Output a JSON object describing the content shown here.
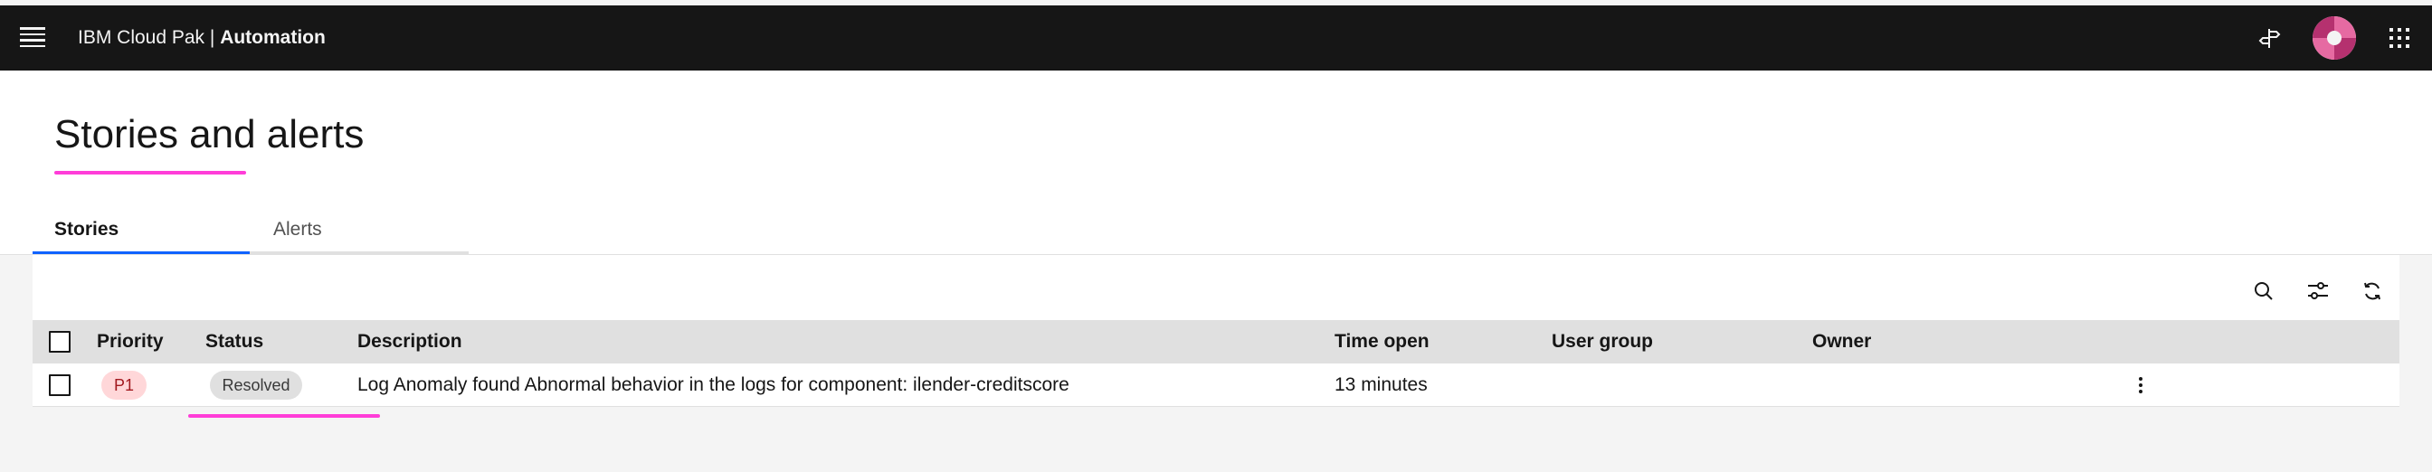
{
  "header": {
    "brand_prefix": "IBM Cloud Pak | ",
    "brand_name": "Automation",
    "icons": [
      "menu-icon",
      "signpost-icon",
      "avatar-icon",
      "app-switcher-icon"
    ]
  },
  "page": {
    "title": "Stories and alerts",
    "accent_color": "#ff3dd8"
  },
  "tabs": [
    {
      "label": "Stories",
      "selected": true
    },
    {
      "label": "Alerts",
      "selected": false
    }
  ],
  "toolbar": {
    "icons": [
      "search-icon",
      "filter-settings-icon",
      "refresh-icon"
    ]
  },
  "table": {
    "columns": [
      "Priority",
      "Status",
      "Description",
      "Time open",
      "User group",
      "Owner"
    ],
    "rows": [
      {
        "priority": "P1",
        "status": "Resolved",
        "description": "Log Anomaly found Abnormal behavior in the logs for component: ilender-creditscore",
        "time_open": "13 minutes",
        "user_group": "",
        "owner": ""
      }
    ]
  },
  "colors": {
    "header_bg": "#161616",
    "tab_selected": "#0f62fe",
    "priority_tag_bg": "#ffd7d9",
    "status_tag_bg": "#e0e0e0"
  }
}
